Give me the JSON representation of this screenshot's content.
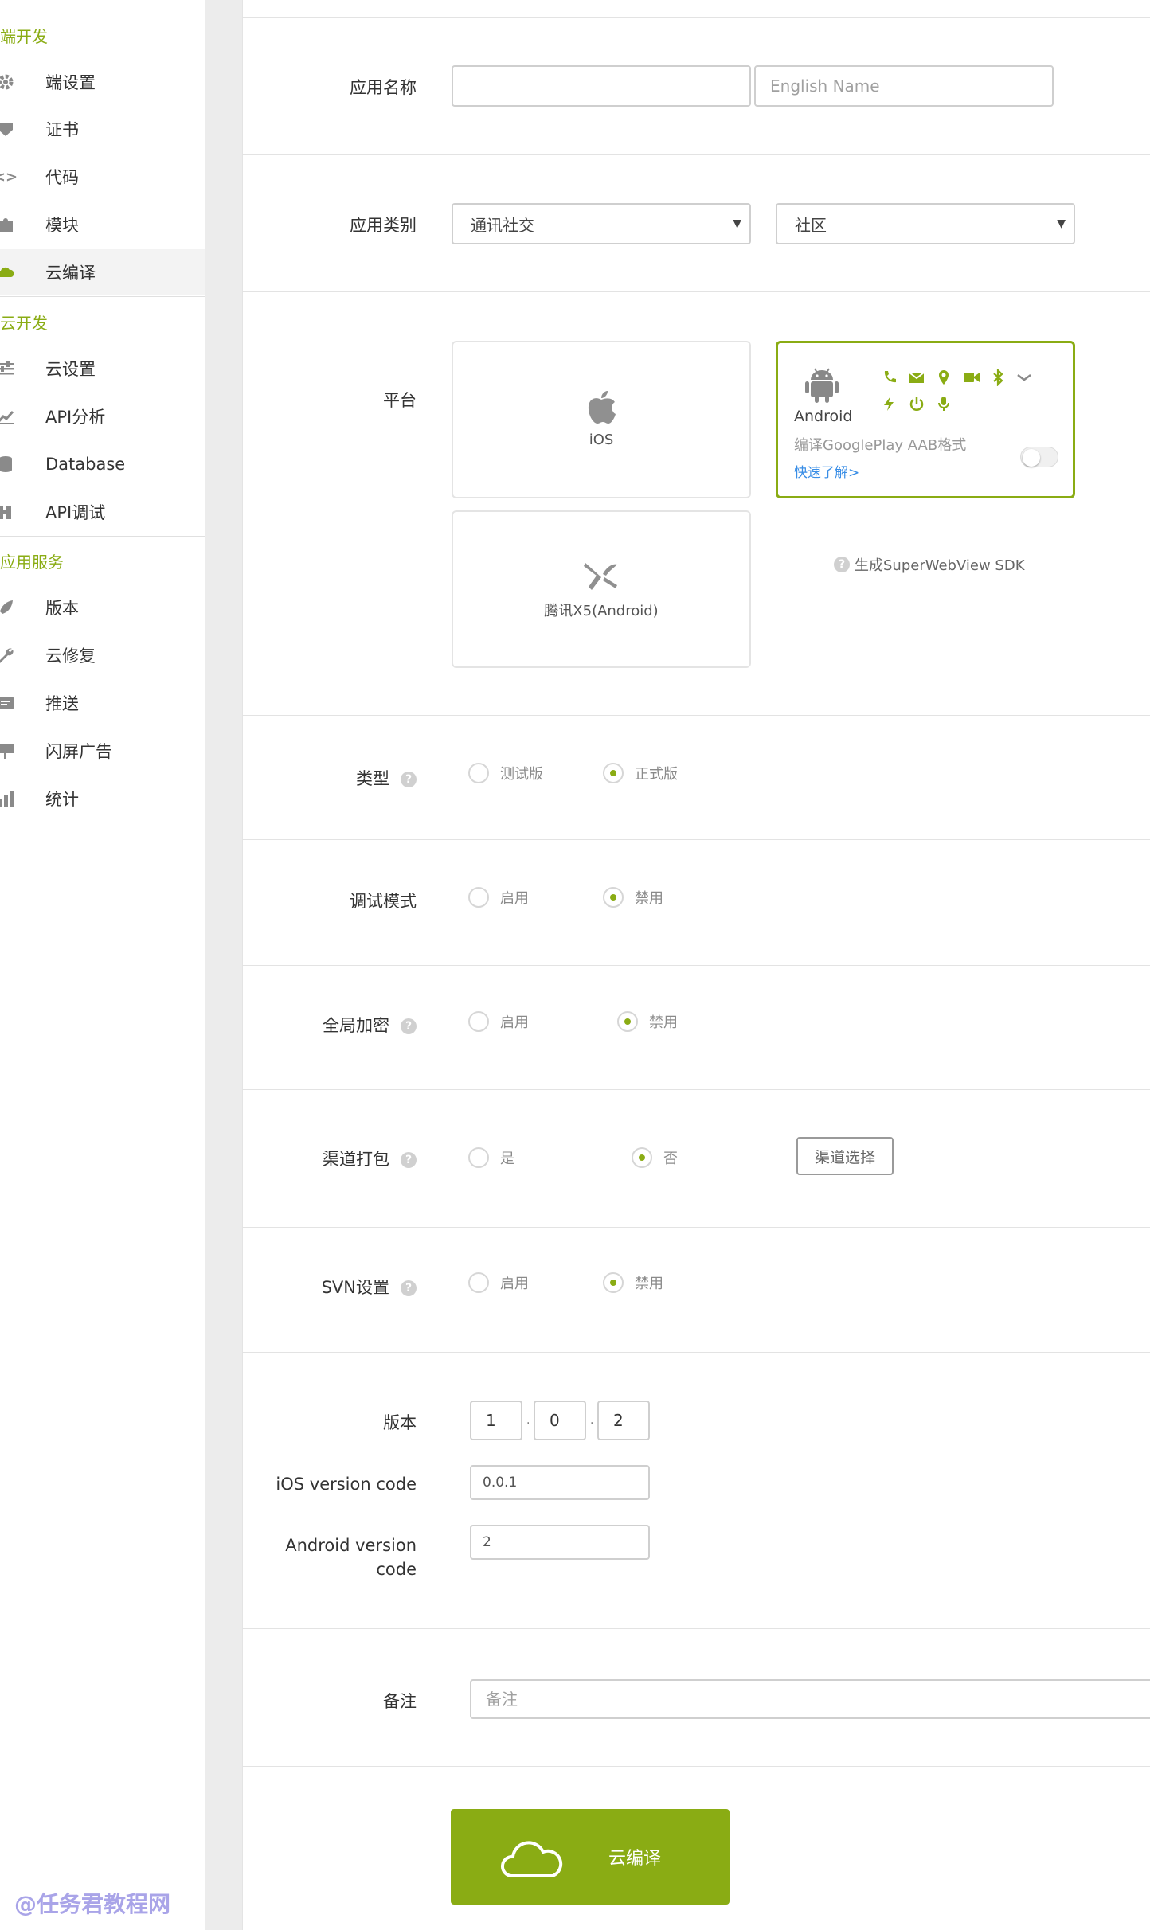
{
  "sidebar": {
    "sections": [
      {
        "title": "端开发",
        "items": [
          {
            "label": "端设置",
            "icon": "gear-icon"
          },
          {
            "label": "证书",
            "icon": "tag-icon"
          },
          {
            "label": "代码",
            "icon": "code-icon"
          },
          {
            "label": "模块",
            "icon": "puzzle-icon"
          },
          {
            "label": "云编译",
            "icon": "cloud-icon",
            "active": true
          }
        ]
      },
      {
        "title": "云开发",
        "items": [
          {
            "label": "云设置",
            "icon": "sliders-icon"
          },
          {
            "label": "API分析",
            "icon": "chart-line-icon"
          },
          {
            "label": "Database",
            "icon": "database-icon"
          },
          {
            "label": "API调试",
            "icon": "debug-icon"
          }
        ]
      },
      {
        "title": "应用服务",
        "items": [
          {
            "label": "版本",
            "icon": "rocket-icon"
          },
          {
            "label": "云修复",
            "icon": "wrench-icon"
          },
          {
            "label": "推送",
            "icon": "push-icon"
          },
          {
            "label": "闪屏广告",
            "icon": "ad-icon"
          },
          {
            "label": "统计",
            "icon": "bar-chart-icon"
          }
        ]
      }
    ],
    "watermark": "@任务君教程网"
  },
  "form": {
    "app_name": {
      "label": "应用名称",
      "value": "",
      "english_placeholder": "English Name"
    },
    "category": {
      "label": "应用类别",
      "primary": "通讯社交",
      "secondary": "社区"
    },
    "platform": {
      "label": "平台",
      "ios": "iOS",
      "android": "Android",
      "aab_text": "编译GooglePlay AAB格式",
      "learn_more": "快速了解>",
      "x5": "腾讯X5(Android)",
      "sdk_text": "生成SuperWebView SDK"
    },
    "type": {
      "label": "类型",
      "opt1": "测试版",
      "opt2": "正式版"
    },
    "debug": {
      "label": "调试模式",
      "opt1": "启用",
      "opt2": "禁用"
    },
    "encrypt": {
      "label": "全局加密",
      "opt1": "启用",
      "opt2": "禁用"
    },
    "channel": {
      "label": "渠道打包",
      "opt1": "是",
      "opt2": "否",
      "button": "渠道选择"
    },
    "svn": {
      "label": "SVN设置",
      "opt1": "启用",
      "opt2": "禁用"
    },
    "version": {
      "label": "版本",
      "major": "1",
      "minor": "0",
      "patch": "2",
      "sep": "."
    },
    "ios_code": {
      "label": "iOS version code",
      "value": "0.0.1"
    },
    "android_code": {
      "label_line1": "Android version",
      "label_line2": "code",
      "value": "2"
    },
    "remark": {
      "label": "备注",
      "placeholder": "备注"
    },
    "submit": {
      "label": "云编译"
    }
  },
  "colors": {
    "accent": "#8aac14",
    "link": "#3a8ee6"
  }
}
